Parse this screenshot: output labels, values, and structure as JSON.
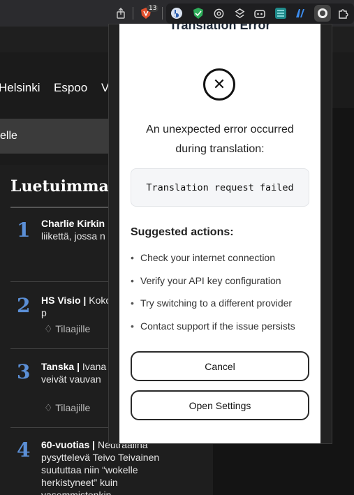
{
  "browser": {
    "brave_badge": "13",
    "toolbar_icons": [
      "share-icon",
      "brave-shield-icon",
      "extension-1-icon",
      "extension-2-icon",
      "openai-icon",
      "layers-icon",
      "bot-icon",
      "grid-icon",
      "ai-n-icon",
      "translation-extension-icon",
      "puzzle-icon"
    ]
  },
  "site": {
    "nav": [
      "Helsinki",
      "Espoo",
      "V"
    ],
    "banner": "elle",
    "most_read": {
      "title": "Luetuimmat",
      "items": [
        {
          "num": "1",
          "bold": "Charlie Kirkin",
          "text": "Kirk valittiin jo liikettä, jossa n kotona",
          "sub": ""
        },
        {
          "num": "2",
          "bold": "HS Visio |",
          "text": "Koko on saamassa p",
          "sub": "Tilaajille"
        },
        {
          "num": "3",
          "bold": "Tanska |",
          "text": "Ivana tunnin ikäinen veivät vauvan",
          "sub": "Tilaajille"
        },
        {
          "num": "4",
          "bold": "60-vuotias |",
          "text": "Neutraalina pysyttelevä Teivo Teivainen suututtaa niin “wokelle herkistyneet” kuin vasemmistonkin",
          "sub": ""
        }
      ]
    }
  },
  "popup": {
    "title": "Translation Error",
    "icon": "x-circle-icon",
    "message": "An unexpected error occurred during translation:",
    "error_code": "Translation request failed",
    "actions_title": "Suggested actions:",
    "actions": [
      "Check your internet connection",
      "Verify your API key configuration",
      "Try switching to a different provider",
      "Contact support if the issue persists"
    ],
    "cancel_label": "Cancel",
    "settings_label": "Open Settings"
  }
}
